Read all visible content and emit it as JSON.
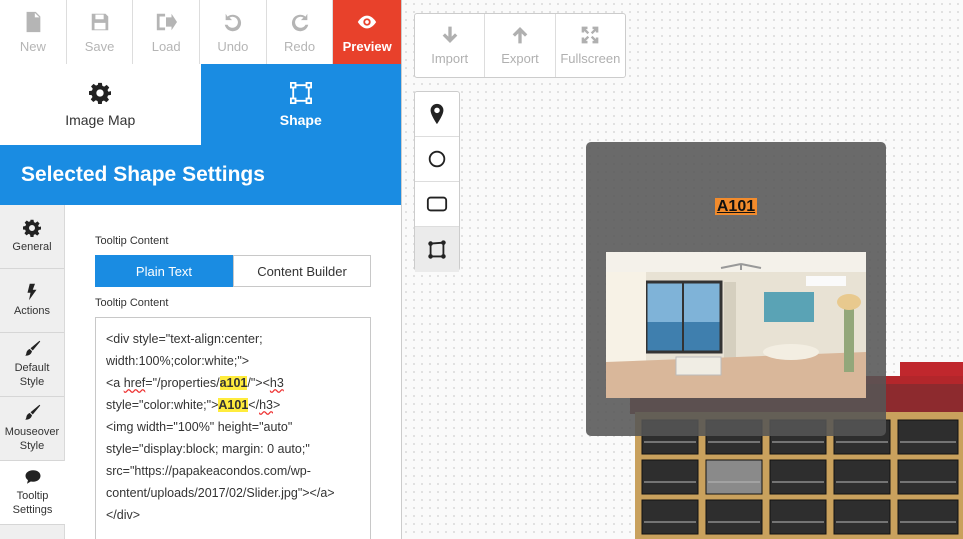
{
  "toolbar": {
    "new": "New",
    "save": "Save",
    "load": "Load",
    "undo": "Undo",
    "redo": "Redo",
    "preview": "Preview"
  },
  "modes": {
    "image_map": "Image Map",
    "shape": "Shape"
  },
  "section_title": "Selected Shape Settings",
  "side_tabs": {
    "general": "General",
    "actions": "Actions",
    "default_style_1": "Default",
    "default_style_2": "Style",
    "mouseover_style_1": "Mouseover",
    "mouseover_style_2": "Style",
    "tooltip_settings_1": "Tooltip",
    "tooltip_settings_2": "Settings"
  },
  "tooltip": {
    "label": "Tooltip Content",
    "plain_text": "Plain Text",
    "content_builder": "Content Builder",
    "content_label": "Tooltip Content",
    "code": {
      "l1": "<div style=\"text-align:center;",
      "l2": "width:100%;color:white;\">",
      "l3a": "<a ",
      "l3b": "href",
      "l3c": "=\"/properties/",
      "l3d": "a101",
      "l3e": "/\"><",
      "l3f": "h3",
      "l4a": "style=\"color:white;\">",
      "l4b": "A101",
      "l4c": "</",
      "l4d": "h3",
      "l4e": ">",
      "l5": "<img width=\"100%\" height=\"auto\"",
      "l6": "style=\"display:block; margin: 0 auto;\"",
      "l7": "src=\"https://papakeacondos.com/wp-",
      "l8": "content/uploads/2017/02/Slider.jpg\"></a>",
      "l9": "</div>"
    }
  },
  "canvas": {
    "import": "Import",
    "export": "Export",
    "fullscreen": "Fullscreen",
    "tooltip_preview_title": "A101"
  },
  "colors": {
    "accent_blue": "#1a8ce2",
    "preview_red": "#e8412b",
    "highlight": "#ffec3d",
    "tooltip_title_bg": "#f28b2c"
  },
  "icons": [
    "file-icon",
    "floppy-icon",
    "load-icon",
    "undo-icon",
    "redo-icon",
    "eye-icon",
    "gear-icon",
    "shape-vector-icon",
    "bolt-icon",
    "brush-icon",
    "comment-icon",
    "download-icon",
    "upload-icon",
    "expand-icon",
    "map-pin-icon",
    "circle-icon",
    "rect-icon",
    "polygon-icon"
  ]
}
